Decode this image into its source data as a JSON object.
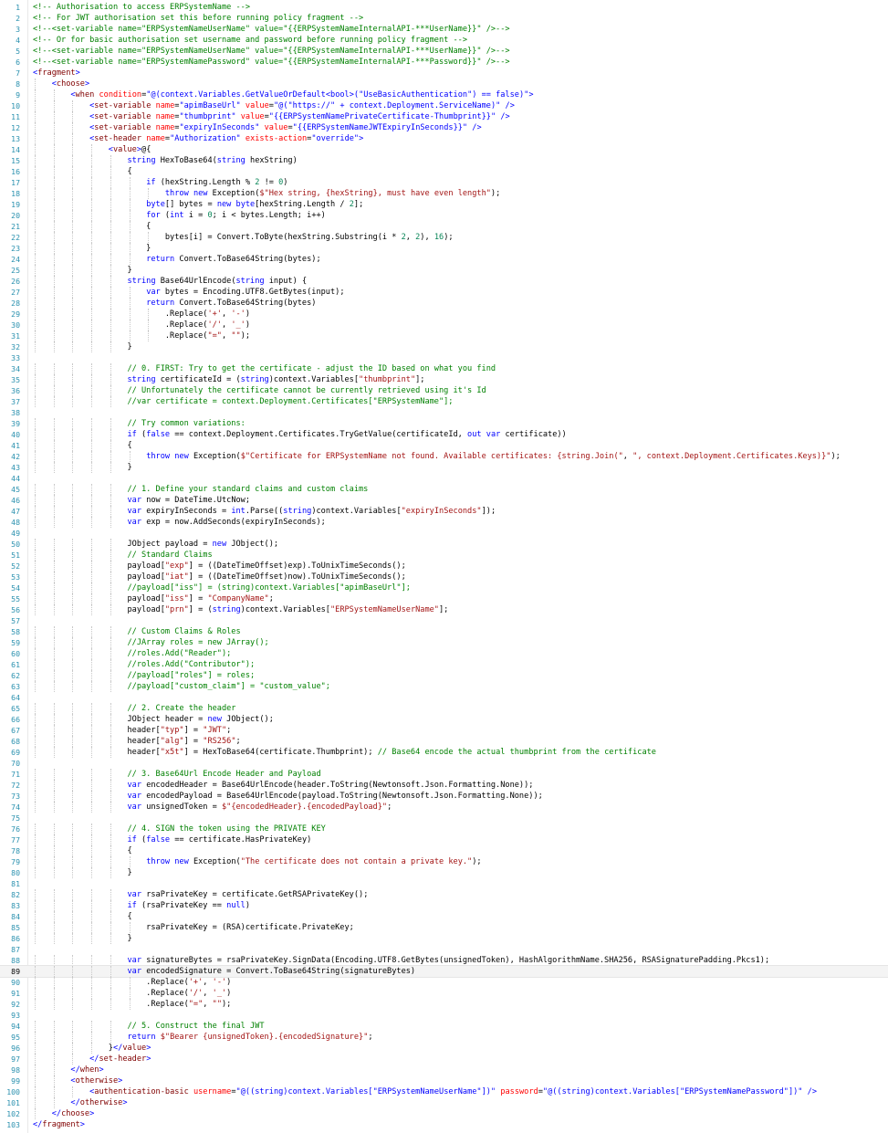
{
  "editor": {
    "name": "policy-code-editor",
    "current_line": 89,
    "lines": [
      "<!-- Authorisation to access ERPSystemName -->",
      "<!-- For JWT authorisation set this before running policy fragment -->",
      "<!--<set-variable name=\"ERPSystemNameUserName\" value=\"{{ERPSystemNameInternalAPI-***UserName}}\" />-->",
      "<!-- Or for basic authorisation set username and password before running policy fragment -->",
      "<!--<set-variable name=\"ERPSystemNameUserName\" value=\"{{ERPSystemNameInternalAPI-***UserName}}\" />-->",
      "<!--<set-variable name=\"ERPSystemNamePassword\" value=\"{{ERPSystemNameInternalAPI-***Password}}\" />-->",
      "<fragment>",
      "    <choose>",
      "        <when condition=\"@(context.Variables.GetValueOrDefault<bool>(\"UseBasicAuthentication\") == false)\">",
      "            <set-variable name=\"apimBaseUrl\" value=\"@(\"https://\" + context.Deployment.ServiceName)\" />",
      "            <set-variable name=\"thumbprint\" value=\"{{ERPSystemNamePrivateCertificate-Thumbprint}}\" />",
      "            <set-variable name=\"expiryInSeconds\" value=\"{{ERPSystemNameJWTExpiryInSeconds}}\" />",
      "            <set-header name=\"Authorization\" exists-action=\"override\">",
      "                <value>@{",
      "                    string HexToBase64(string hexString)",
      "                    {",
      "                        if (hexString.Length % 2 != 0)",
      "                            throw new Exception($\"Hex string, {hexString}, must have even length\");",
      "                        byte[] bytes = new byte[hexString.Length / 2];",
      "                        for (int i = 0; i < bytes.Length; i++)",
      "                        {",
      "                            bytes[i] = Convert.ToByte(hexString.Substring(i * 2, 2), 16);",
      "                        }",
      "                        return Convert.ToBase64String(bytes);",
      "                    }",
      "                    string Base64UrlEncode(string input) {",
      "                        var bytes = Encoding.UTF8.GetBytes(input);",
      "                        return Convert.ToBase64String(bytes)",
      "                            .Replace('+', '-')",
      "                            .Replace('/', '_')",
      "                            .Replace(\"=\", \"\");",
      "                    }",
      "",
      "                    // 0. FIRST: Try to get the certificate - adjust the ID based on what you find",
      "                    string certificateId = (string)context.Variables[\"thumbprint\"];",
      "                    // Unfortunately the certificate cannot be currently retrieved using it's Id",
      "                    //var certificate = context.Deployment.Certificates[\"ERPSystemName\"];",
      "",
      "                    // Try common variations:",
      "                    if (false == context.Deployment.Certificates.TryGetValue(certificateId, out var certificate))",
      "                    {",
      "                        throw new Exception($\"Certificate for ERPSystemName not found. Available certificates: {string.Join(\", \", context.Deployment.Certificates.Keys)}\");",
      "                    }",
      "",
      "                    // 1. Define your standard claims and custom claims",
      "                    var now = DateTime.UtcNow;",
      "                    var expiryInSeconds = int.Parse((string)context.Variables[\"expiryInSeconds\"]);",
      "                    var exp = now.AddSeconds(expiryInSeconds);",
      "",
      "                    JObject payload = new JObject();",
      "                    // Standard Claims",
      "                    payload[\"exp\"] = ((DateTimeOffset)exp).ToUnixTimeSeconds();",
      "                    payload[\"iat\"] = ((DateTimeOffset)now).ToUnixTimeSeconds();",
      "                    //payload[\"iss\"] = (string)context.Variables[\"apimBaseUrl\"];",
      "                    payload[\"iss\"] = \"CompanyName\";",
      "                    payload[\"prn\"] = (string)context.Variables[\"ERPSystemNameUserName\"];",
      "",
      "                    // Custom Claims & Roles",
      "                    //JArray roles = new JArray();",
      "                    //roles.Add(\"Reader\");",
      "                    //roles.Add(\"Contributor\");",
      "                    //payload[\"roles\"] = roles;",
      "                    //payload[\"custom_claim\"] = \"custom_value\";",
      "",
      "                    // 2. Create the header",
      "                    JObject header = new JObject();",
      "                    header[\"typ\"] = \"JWT\";",
      "                    header[\"alg\"] = \"RS256\";",
      "                    header[\"x5t\"] = HexToBase64(certificate.Thumbprint); // Base64 encode the actual thumbprint from the certificate",
      "",
      "                    // 3. Base64Url Encode Header and Payload",
      "                    var encodedHeader = Base64UrlEncode(header.ToString(Newtonsoft.Json.Formatting.None));",
      "                    var encodedPayload = Base64UrlEncode(payload.ToString(Newtonsoft.Json.Formatting.None));",
      "                    var unsignedToken = $\"{encodedHeader}.{encodedPayload}\";",
      "",
      "                    // 4. SIGN the token using the PRIVATE KEY",
      "                    if (false == certificate.HasPrivateKey)",
      "                    {",
      "                        throw new Exception(\"The certificate does not contain a private key.\");",
      "                    }",
      "",
      "                    var rsaPrivateKey = certificate.GetRSAPrivateKey();",
      "                    if (rsaPrivateKey == null)",
      "                    {",
      "                        rsaPrivateKey = (RSA)certificate.PrivateKey;",
      "                    }",
      "",
      "                    var signatureBytes = rsaPrivateKey.SignData(Encoding.UTF8.GetBytes(unsignedToken), HashAlgorithmName.SHA256, RSASignaturePadding.Pkcs1);",
      "                    var encodedSignature = Convert.ToBase64String(signatureBytes)",
      "                        .Replace('+', '-')",
      "                        .Replace('/', '_')",
      "                        .Replace(\"=\", \"\");",
      "",
      "                    // 5. Construct the final JWT",
      "                    return $\"Bearer {unsignedToken}.{encodedSignature}\";",
      "                }</value>",
      "            </set-header>",
      "        </when>",
      "        <otherwise>",
      "            <authentication-basic username=\"@((string)context.Variables[\"ERPSystemNameUserName\"])\" password=\"@((string)context.Variables[\"ERPSystemNamePassword\"])\" />",
      "        </otherwise>",
      "    </choose>",
      "</fragment>"
    ]
  }
}
